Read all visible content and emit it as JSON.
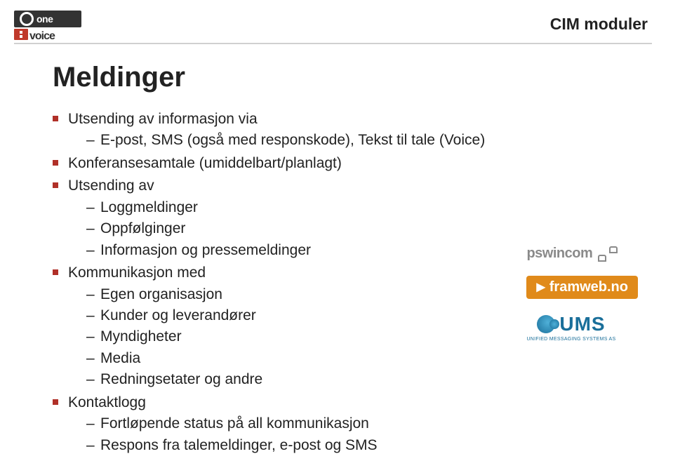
{
  "header": {
    "logo_line1": "one",
    "logo_line2": "voice",
    "section_title": "CIM moduler"
  },
  "slide": {
    "title": "Meldinger",
    "items": [
      {
        "label": "Utsending av informasjon via",
        "children": [
          "E-post, SMS (også med responskode), Tekst til tale (Voice)"
        ]
      },
      {
        "label": "Konferansesamtale (umiddelbart/planlagt)"
      },
      {
        "label": "Utsending av",
        "children": [
          "Loggmeldinger",
          "Oppfølginger",
          "Informasjon og pressemeldinger"
        ]
      },
      {
        "label": "Kommunikasjon med",
        "children": [
          "Egen organisasjon",
          "Kunder og leverandører",
          "Myndigheter",
          "Media",
          "Redningsetater og andre"
        ]
      },
      {
        "label": "Kontaktlogg",
        "children": [
          "Fortløpende status på all kommunikasjon",
          "Respons fra talemeldinger, e-post og SMS"
        ]
      }
    ]
  },
  "partner_logos": {
    "pswincom": "pswincom",
    "framweb": "framweb.no",
    "ums": "UMS",
    "ums_sub": "UNIFIED MESSAGING SYSTEMS AS"
  },
  "colors": {
    "bullet": "#b03028",
    "framweb_bg": "#e08a1a",
    "ums_blue": "#1a6f9a"
  }
}
